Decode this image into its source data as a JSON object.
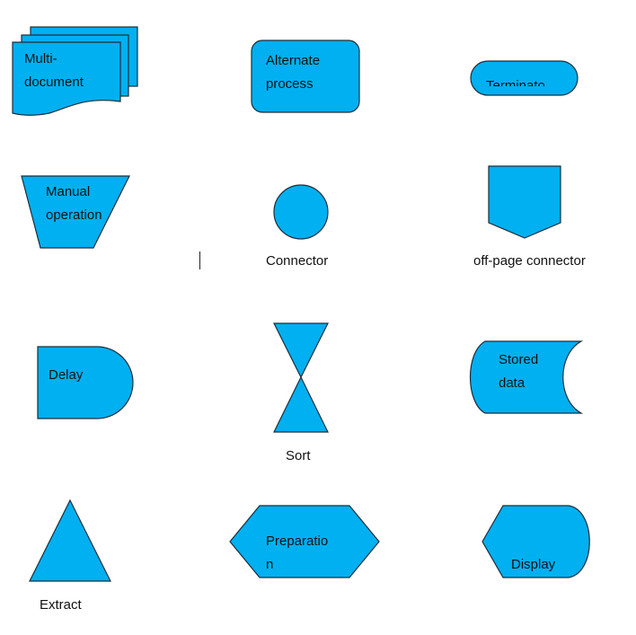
{
  "colors": {
    "shape_fill": "#00B0F0",
    "shape_stroke": "#1f2d3a"
  },
  "shapes": {
    "multi_document": {
      "line1": "Multi-",
      "line2": "document"
    },
    "alternate_process": {
      "line1": "Alternate",
      "line2": "process"
    },
    "terminator": {
      "label": "Terminato"
    },
    "manual_operation": {
      "line1": "Manual",
      "line2": "operation"
    },
    "connector": {
      "label": "Connector"
    },
    "off_page_connector": {
      "label": "off-page connector"
    },
    "delay": {
      "label": "Delay"
    },
    "sort": {
      "label": "Sort"
    },
    "stored_data": {
      "line1": "Stored",
      "line2": "data"
    },
    "extract": {
      "label": "Extract"
    },
    "preparation": {
      "line1": "Preparatio",
      "line2": "n"
    },
    "display": {
      "label": "Display"
    }
  }
}
